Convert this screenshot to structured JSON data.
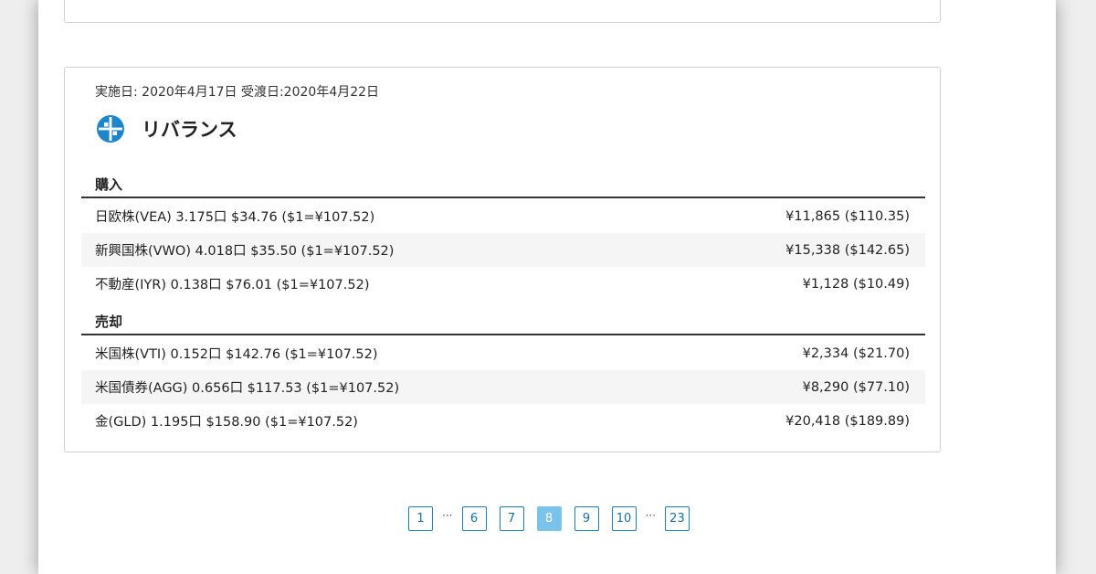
{
  "card": {
    "dates": "実施日: 2020年4月17日 受渡日:2020年4月22日",
    "title": "リバランス",
    "icon": "rebalance-circle-icon",
    "accent_color": "#1e86c8"
  },
  "buy": {
    "label": "購入",
    "rows": [
      {
        "desc": "日欧株(VEA) 3.175口 $34.76 ($1=¥107.52)",
        "amount": "¥11,865 ($110.35)"
      },
      {
        "desc": "新興国株(VWO) 4.018口 $35.50 ($1=¥107.52)",
        "amount": "¥15,338 ($142.65)"
      },
      {
        "desc": "不動産(IYR) 0.138口 $76.01 ($1=¥107.52)",
        "amount": "¥1,128 ($10.49)"
      }
    ]
  },
  "sell": {
    "label": "売却",
    "rows": [
      {
        "desc": "米国株(VTI) 0.152口 $142.76 ($1=¥107.52)",
        "amount": "¥2,334 ($21.70)"
      },
      {
        "desc": "米国債券(AGG) 0.656口 $117.53 ($1=¥107.52)",
        "amount": "¥8,290 ($77.10)"
      },
      {
        "desc": "金(GLD) 1.195口 $158.90 ($1=¥107.52)",
        "amount": "¥20,418 ($189.89)"
      }
    ]
  },
  "pagination": {
    "pages": [
      "1",
      "6",
      "7",
      "8",
      "9",
      "10",
      "23"
    ],
    "ellipsis": "···",
    "active": "8",
    "colors": {
      "border": "#1a7fb3",
      "active_bg": "#7cc3eb"
    }
  }
}
